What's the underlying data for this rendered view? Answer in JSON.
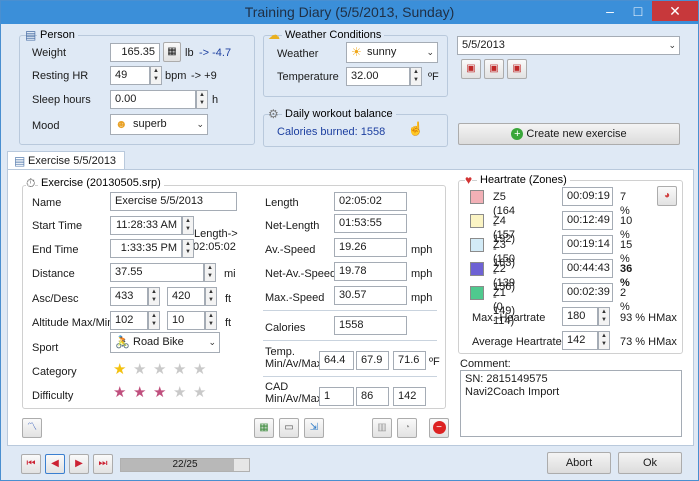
{
  "window": {
    "title": "Training Diary (5/5/2013, Sunday)",
    "min": "–",
    "max": "□",
    "close": "✕"
  },
  "person": {
    "title": "Person",
    "weight_label": "Weight",
    "weight": "165.35",
    "weight_unit": "lb",
    "weight_delta": "-> -4.7",
    "rhr_label": "Resting HR",
    "rhr": "49",
    "rhr_unit": "bpm",
    "rhr_delta": "-> +9",
    "sleep_label": "Sleep hours",
    "sleep": "0.00",
    "sleep_unit": "h",
    "mood_label": "Mood",
    "mood": "superb"
  },
  "weather": {
    "title": "Weather Conditions",
    "weather_label": "Weather",
    "weather": "sunny",
    "temp_label": "Temperature",
    "temp": "32.00",
    "temp_unit": "ºF"
  },
  "daily": {
    "title": "Daily workout balance",
    "calories": "Calories burned: 1558"
  },
  "date_combo": "5/5/2013",
  "create_btn": "Create new exercise",
  "tab_label": "Exercise 5/5/2013",
  "exercise": {
    "title": "Exercise (20130505.srp)",
    "name_label": "Name",
    "name": "Exercise 5/5/2013",
    "start_label": "Start Time",
    "start": "11:28:33 AM",
    "end_label": "End Time",
    "end": "1:33:35 PM",
    "length_note": "Length->",
    "length_note_val": "02:05:02",
    "distance_label": "Distance",
    "distance": "37.55",
    "distance_unit": "mi",
    "ascdesc_label": "Asc/Desc",
    "asc": "433",
    "desc": "420",
    "ascdesc_unit": "ft",
    "alt_label": "Altitude Max/Min",
    "alt_max": "102",
    "alt_min": "10",
    "alt_unit": "ft",
    "sport_label": "Sport",
    "sport": "Road Bike",
    "category_label": "Category",
    "category_stars": 1,
    "difficulty_label": "Difficulty",
    "difficulty_stars": 3
  },
  "metrics": {
    "length_label": "Length",
    "length": "02:05:02",
    "netlength_label": "Net-Length",
    "netlength": "01:53:55",
    "avspeed_label": "Av.-Speed",
    "avspeed": "19.26",
    "netavspeed_label": "Net-Av.-Speed",
    "netavspeed": "19.78",
    "maxspeed_label": "Max.-Speed",
    "maxspeed": "30.57",
    "speed_unit": "mph",
    "calories_label": "Calories",
    "calories": "1558",
    "temp_label": "Temp. Min/Av/Max",
    "temp_min": "64.4",
    "temp_av": "67.9",
    "temp_max": "71.6",
    "temp_unit": "ºF",
    "cad_label": "CAD Min/Av/Max",
    "cad_min": "1",
    "cad_av": "86",
    "cad_max": "142"
  },
  "heartrate": {
    "title": "Heartrate (Zones)",
    "zones": [
      {
        "label": "Z5 (164 - 192)",
        "time": "00:09:19",
        "pct": "7 %",
        "color": "#f2b0b6"
      },
      {
        "label": "Z4 (157 - 163)",
        "time": "00:12:49",
        "pct": "10 %",
        "color": "#fbf4c4"
      },
      {
        "label": "Z3 (150 - 156)",
        "time": "00:19:14",
        "pct": "15 %",
        "color": "#d3ebf7"
      },
      {
        "label": "Z2 (139 - 149)",
        "time": "00:44:43",
        "pct": "36 %",
        "color": "#6e62d4"
      },
      {
        "label": "Z1 (0 - 114)",
        "time": "00:02:39",
        "pct": "2 %",
        "color": "#4fc98e"
      }
    ],
    "maxhr_label": "Max.-Heartrate",
    "maxhr": "180",
    "maxhr_pct": "93 % HMax",
    "avghr_label": "Average Heartrate",
    "avghr": "142",
    "avghr_pct": "73 % HMax"
  },
  "comment": {
    "label": "Comment:",
    "line1": "SN: 2815149575",
    "line2": "Navi2Coach Import"
  },
  "nav": {
    "page": "22/25",
    "progress": 0.88,
    "cancel": "Abort",
    "ok": "Ok"
  }
}
